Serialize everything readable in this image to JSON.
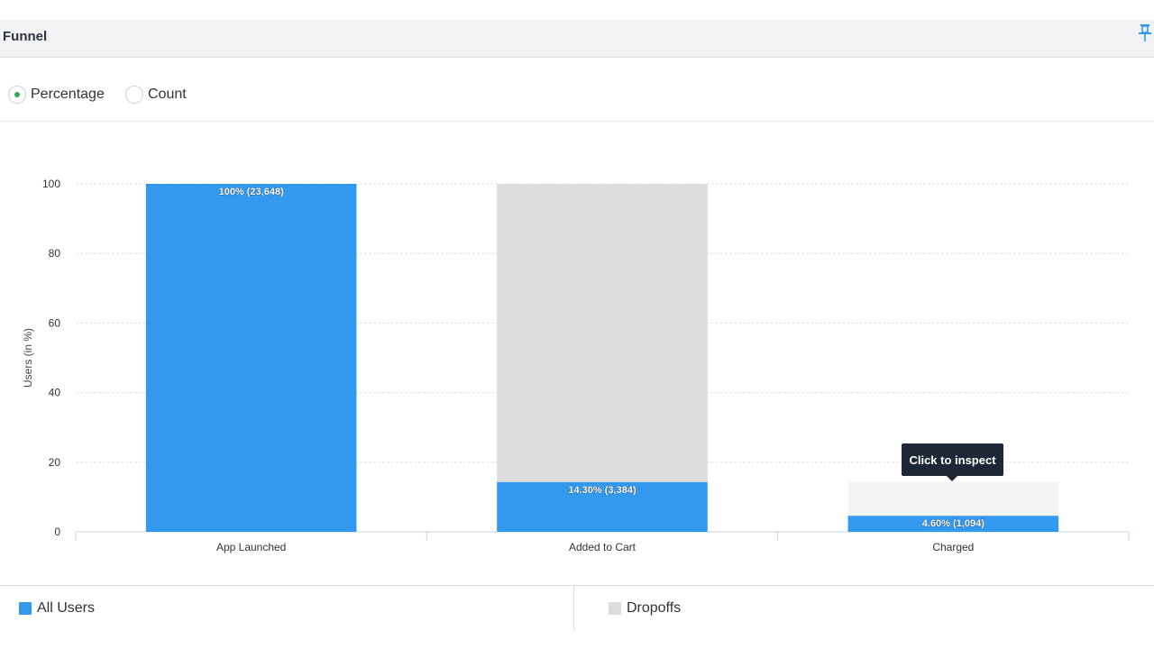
{
  "panel": {
    "title": "Funnel"
  },
  "toggle": {
    "percentage_label": "Percentage",
    "count_label": "Count",
    "selected": "Percentage"
  },
  "tooltip": {
    "text": "Click to inspect"
  },
  "legend": {
    "all_users": "All Users",
    "dropoffs": "Dropoffs"
  },
  "colors": {
    "all_users": "#3399ee",
    "dropoffs": "#dcdcdc",
    "dropoffs_hover": "#f3f3f3",
    "tooltip_bg": "#1d2736",
    "accent": "#34a853"
  },
  "chart_data": {
    "type": "bar",
    "stacked": true,
    "categories": [
      "App Launched",
      "Added to Cart",
      "Charged"
    ],
    "series": [
      {
        "name": "All Users",
        "values": [
          100,
          14.3,
          4.6
        ]
      },
      {
        "name": "Dropoffs",
        "values": [
          0,
          85.7,
          9.7
        ]
      }
    ],
    "data_labels": [
      "100% (23,648)",
      "14.30% (3,384)",
      "4.60% (1,094)"
    ],
    "counts": [
      23648,
      3384,
      1094
    ],
    "ylabel": "Users (in %)",
    "xlabel": "",
    "ylim": [
      0,
      100
    ],
    "yticks": [
      0,
      20,
      40,
      60,
      80,
      100
    ],
    "grid": true,
    "legend_position": "bottom"
  }
}
